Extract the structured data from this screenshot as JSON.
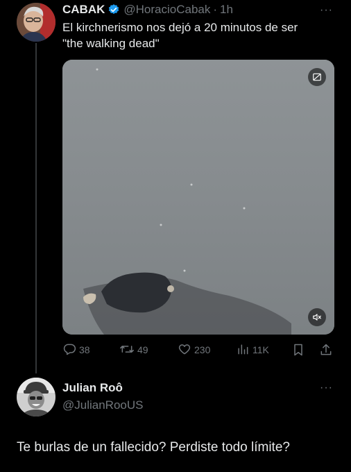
{
  "tweet1": {
    "name": "CABAK",
    "handle": "@HoracioCabak",
    "separator": "·",
    "time": "1h",
    "more": "···",
    "text_line1": "El  kirchnerismo nos dejó a 20 minutos de ser",
    "text_line2": "\"the walking dead\"",
    "metrics": {
      "replies": "38",
      "retweets": "49",
      "likes": "230",
      "views": "11K"
    }
  },
  "tweet2": {
    "name": "Julian Roô",
    "handle": "@JulianRooUS",
    "more": "···",
    "text": "Te burlas de un fallecido? Perdiste todo límite?"
  },
  "colors": {
    "background": "#000000",
    "primary_text": "#e7e9ea",
    "secondary_text": "#71767b",
    "verified": "#1d9bf0",
    "thread_line": "#333639"
  },
  "icons": [
    "verified-badge-icon",
    "more-icon",
    "reply-icon",
    "retweet-icon",
    "like-icon",
    "views-icon",
    "bookmark-icon",
    "share-icon",
    "media-toggle-icon",
    "mute-icon"
  ]
}
